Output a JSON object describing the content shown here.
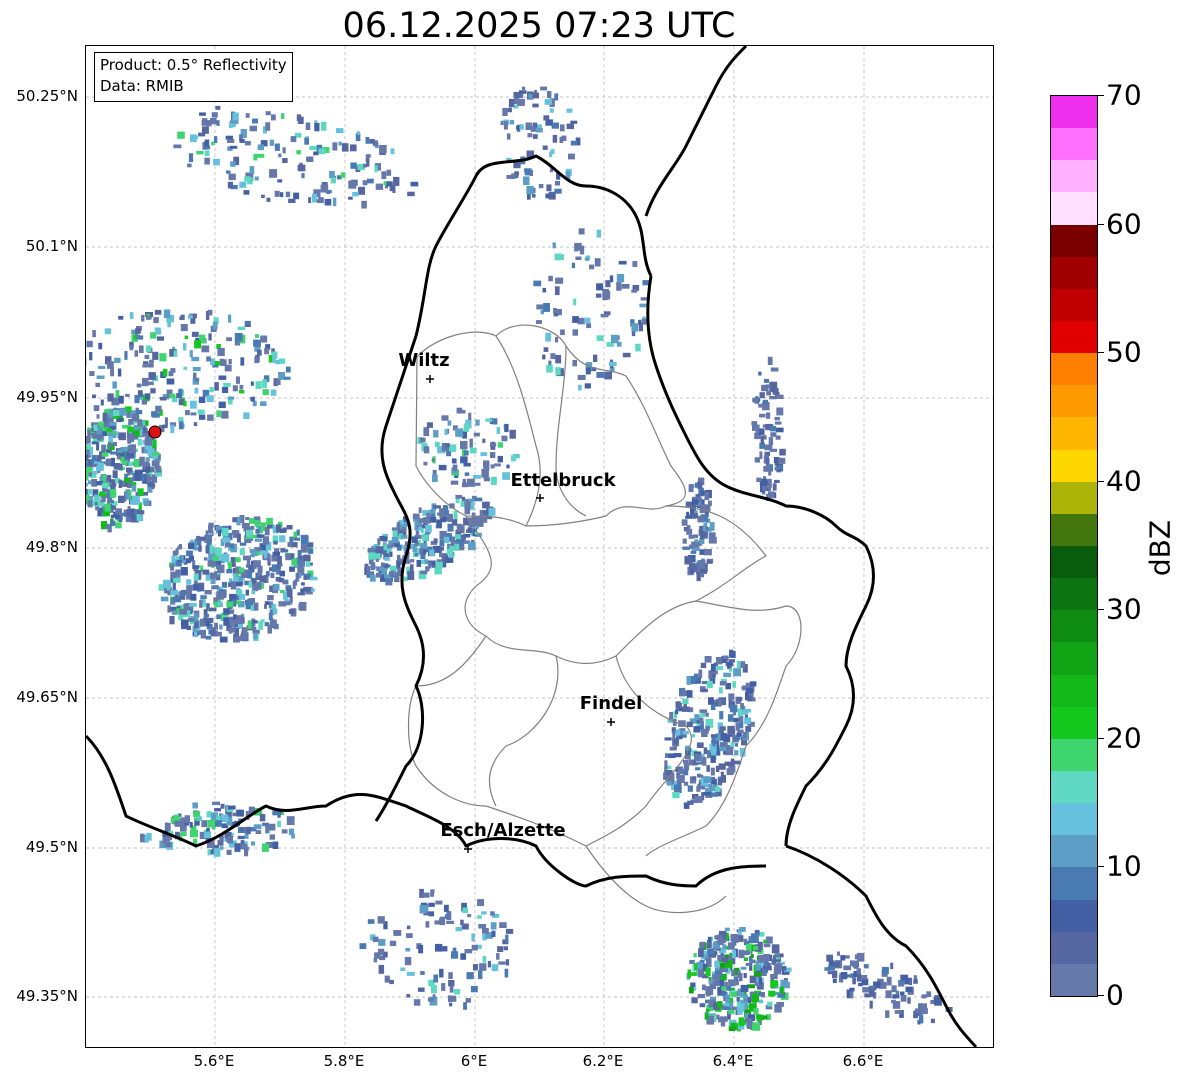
{
  "title": "06.12.2025 07:23 UTC",
  "info": {
    "product": "Product: 0.5° Reflectivity",
    "data": "Data: RMIB"
  },
  "lat_ticks": [
    "50.25°N",
    "50.1°N",
    "49.95°N",
    "49.8°N",
    "49.65°N",
    "49.5°N",
    "49.35°N"
  ],
  "lon_ticks": [
    "5.6°E",
    "5.8°E",
    "6°E",
    "6.2°E",
    "6.4°E",
    "6.6°E"
  ],
  "cities": [
    {
      "name": "Wiltz"
    },
    {
      "name": "Ettelbruck"
    },
    {
      "name": "Findel"
    },
    {
      "name": "Esch/Alzette"
    }
  ],
  "colorbar": {
    "label": "dBZ",
    "min": 0,
    "max": 70,
    "tick_labels": [
      "0",
      "10",
      "20",
      "30",
      "40",
      "50",
      "60",
      "70"
    ],
    "colors": [
      "#6677aa",
      "#5566a0",
      "#4460a4",
      "#4a7ab2",
      "#5d9ec6",
      "#66c2dc",
      "#5ed8c2",
      "#3ed46e",
      "#14c81e",
      "#12b818",
      "#10a414",
      "#0e8c12",
      "#0c7410",
      "#095c0c",
      "#43760c",
      "#adb408",
      "#fed600",
      "#feb600",
      "#fe9a00",
      "#fe7e00",
      "#e00000",
      "#c00000",
      "#a00000",
      "#7a0000",
      "#ffe0ff",
      "#ffb0ff",
      "#ff70ff",
      "#ee30ee"
    ]
  },
  "colors": {
    "border": "#000000",
    "canton_border": "#808080",
    "grid": "#b0b0b0",
    "radar_site": "#e01010"
  }
}
